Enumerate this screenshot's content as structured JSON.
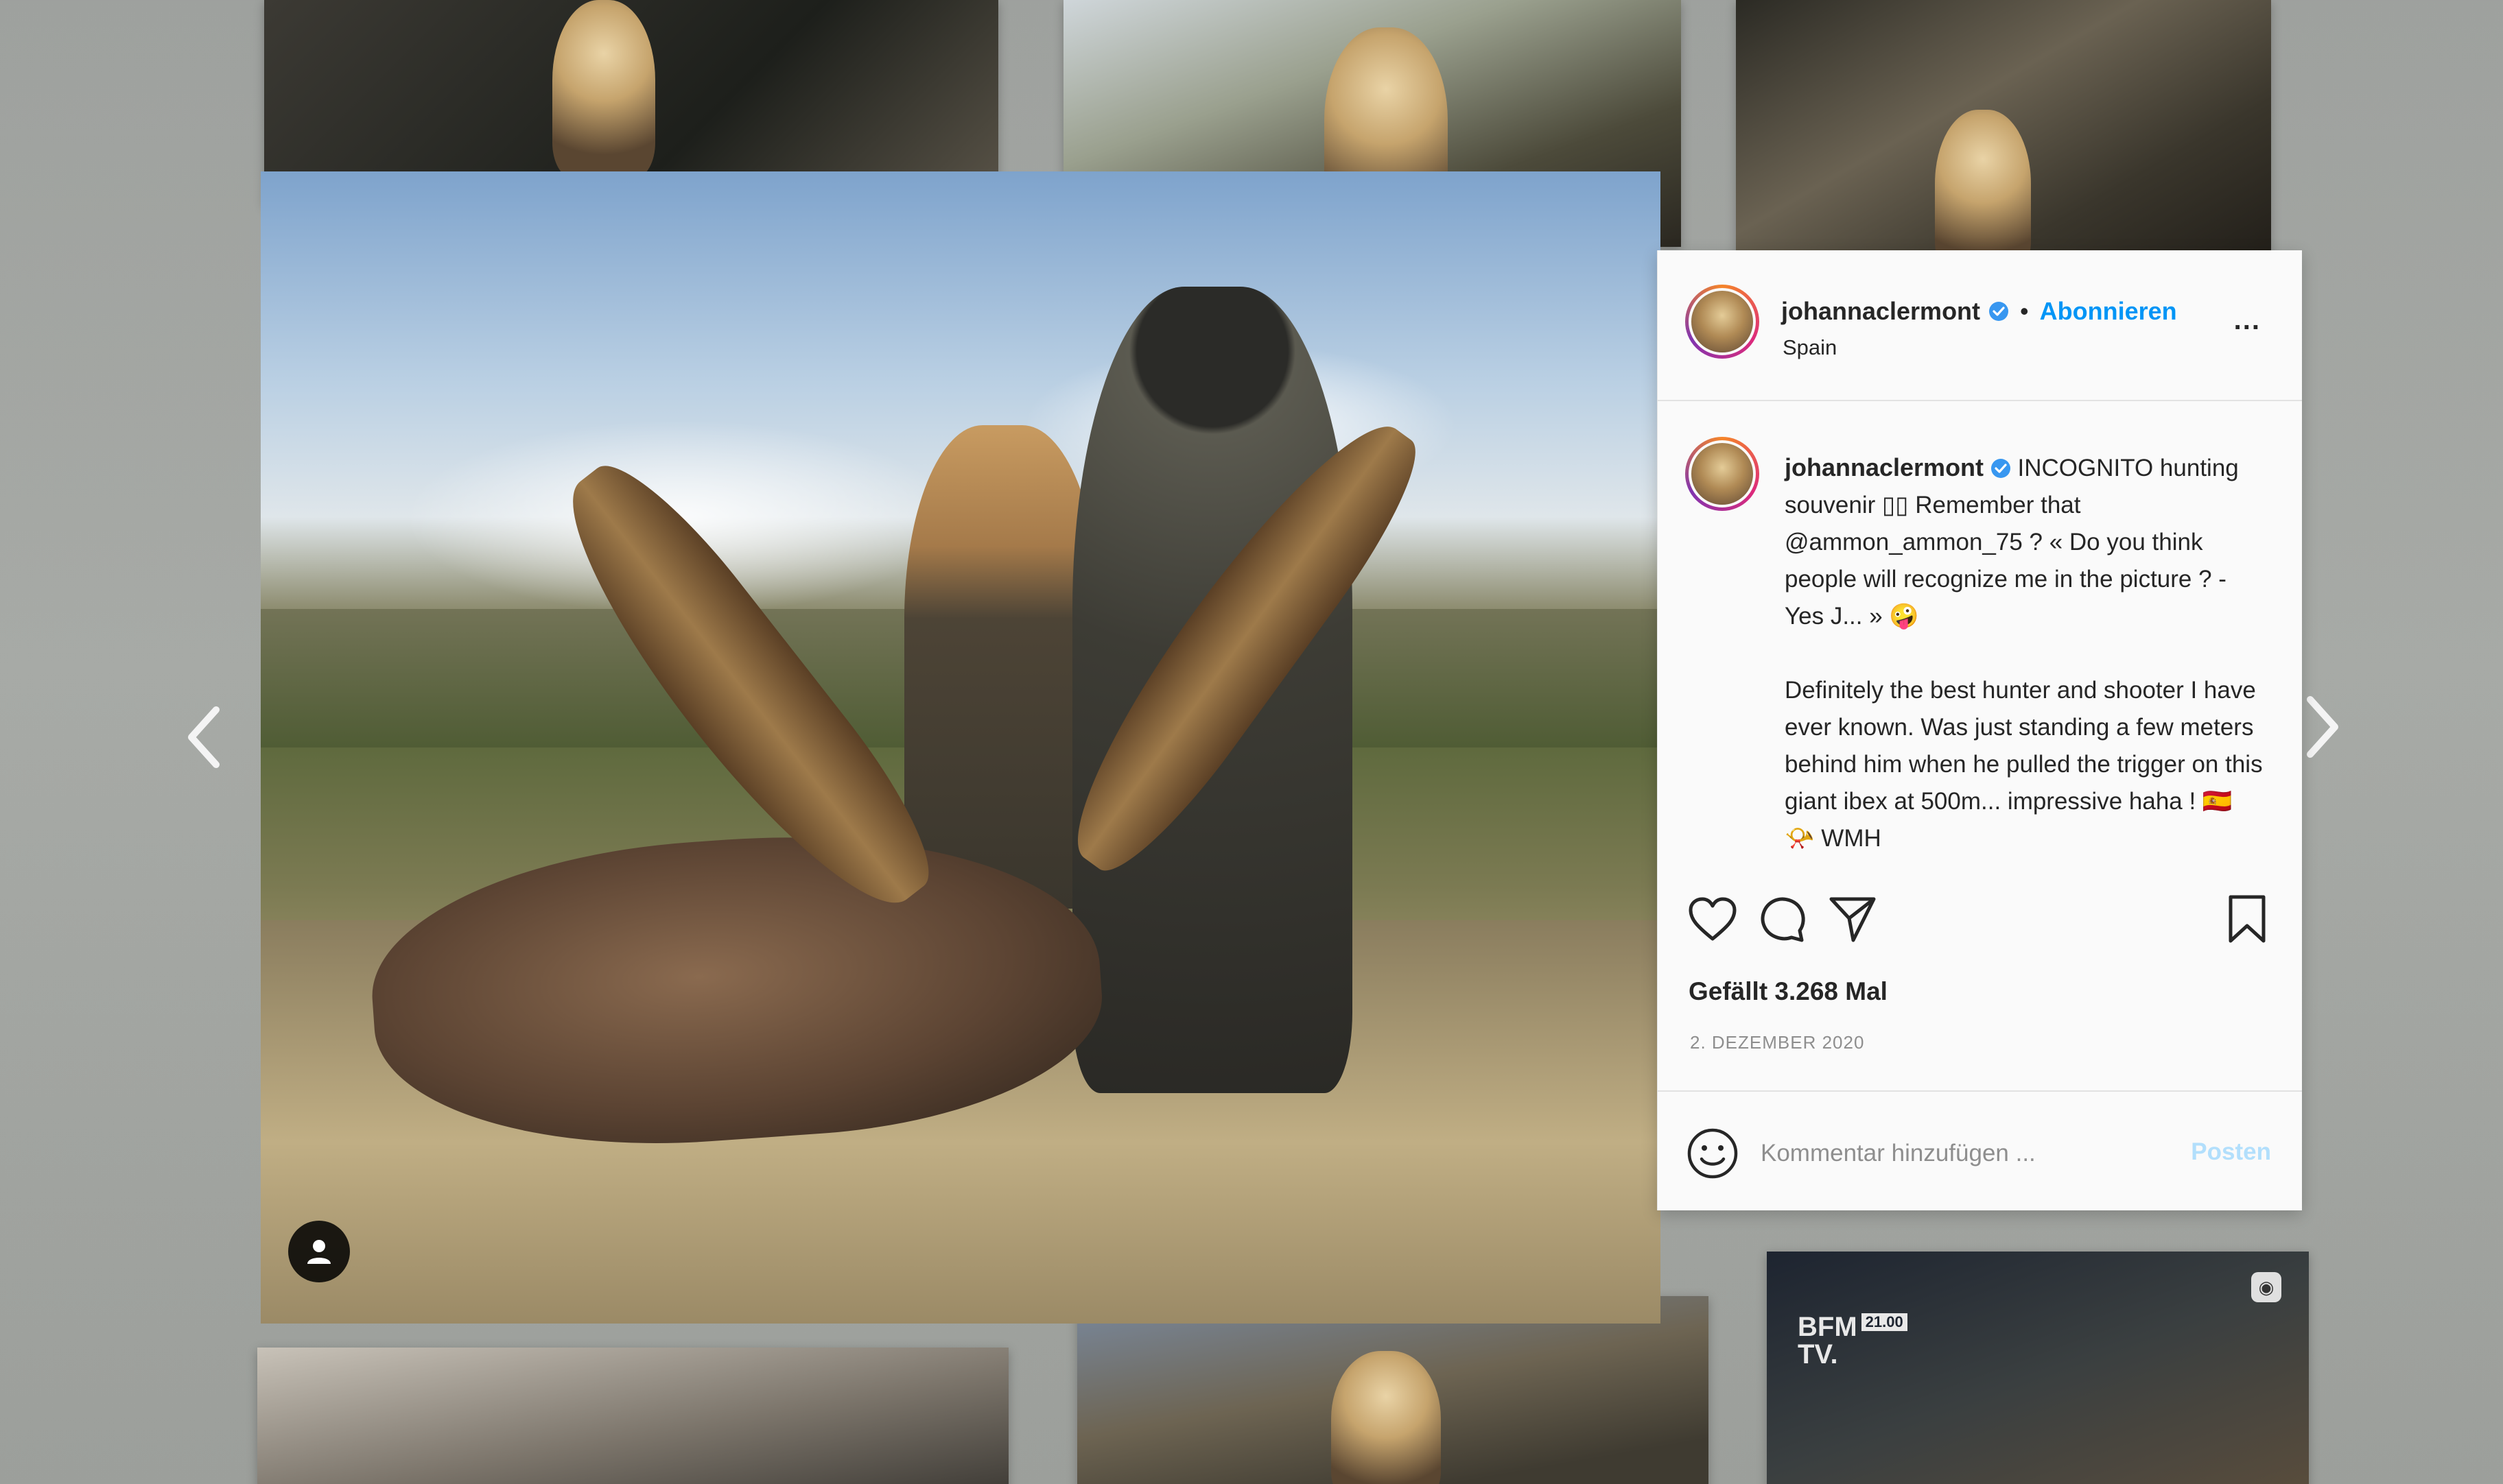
{
  "post": {
    "username": "johannaclermont",
    "follow_label": "Abonnieren",
    "dot_separator": "•",
    "location": "Spain",
    "more_label": "...",
    "caption_line_1": "INCOGNITO hunting souvenir ▯▯ Remember that @ammon_ammon_75 ? « Do you think people will recognize me in the picture ? -Yes J... » 🤪",
    "caption_line_2": "Definitely the best hunter and shooter I have ever known. Was just standing a few meters behind him when he pulled the trigger on this giant ibex at 500m... impressive haha ! 🇪🇸 📯 WMH",
    "likes_text": "Gefällt 3.268 Mal",
    "date_text": "2. DEZEMBER 2020"
  },
  "comment": {
    "placeholder": "Kommentar hinzufügen ...",
    "post_label": "Posten"
  },
  "grid": {
    "bfm_logo_line1": "BFM",
    "bfm_logo_line2": "TV.",
    "bfm_time": "21.00"
  },
  "colors": {
    "accent_blue": "#0095f6",
    "post_button_disabled": "#b2dffc",
    "text_primary": "#262626",
    "text_secondary": "#8e8e8e",
    "panel_background": "#fafafa"
  },
  "icons": {
    "prev": "chevron-left-icon",
    "next": "chevron-right-icon",
    "like": "heart-icon",
    "comment": "comment-bubble-icon",
    "share": "paper-plane-icon",
    "save": "bookmark-icon",
    "emoji": "smiley-icon",
    "verified": "verified-badge-icon",
    "tag": "user-tag-icon"
  }
}
